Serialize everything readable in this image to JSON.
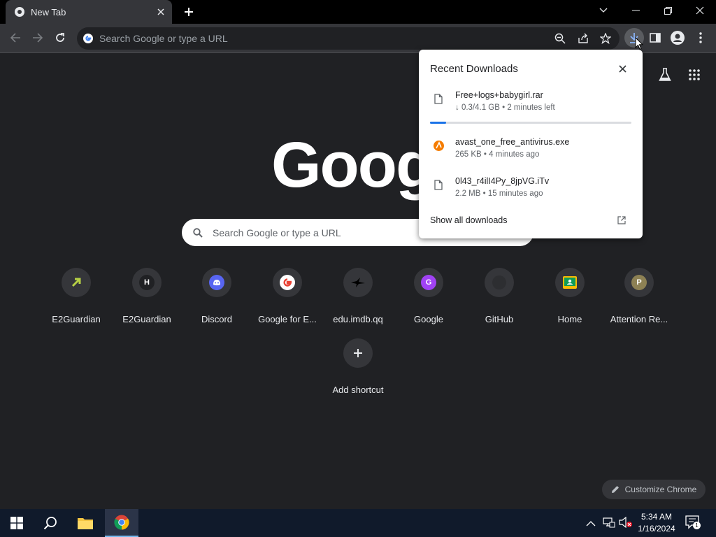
{
  "tab": {
    "title": "New Tab"
  },
  "omnibox": {
    "placeholder": "Search Google or type a URL"
  },
  "ntp": {
    "logo_text": "Googl",
    "search_placeholder": "Search Google or type a URL",
    "shortcuts": [
      {
        "label": "E2Guardian",
        "icon": "e2guardian-icon",
        "letter": ""
      },
      {
        "label": "E2Guardian",
        "icon": "letter-h-icon",
        "letter": "H"
      },
      {
        "label": "Discord",
        "icon": "discord-icon",
        "letter": ""
      },
      {
        "label": "Google for E...",
        "icon": "google-g-icon",
        "letter": ""
      },
      {
        "label": "edu.imdb.qq",
        "icon": "bird-icon",
        "letter": ""
      },
      {
        "label": "Google",
        "icon": "letter-g-icon",
        "letter": "G"
      },
      {
        "label": "GitHub",
        "icon": "github-icon",
        "letter": ""
      },
      {
        "label": "Home",
        "icon": "classroom-icon",
        "letter": ""
      },
      {
        "label": "Attention Re...",
        "icon": "letter-p-icon",
        "letter": "P"
      }
    ],
    "add_shortcut": "Add shortcut",
    "customize": "Customize Chrome"
  },
  "downloads": {
    "title": "Recent Downloads",
    "items": [
      {
        "name": "Free+logs+babygirl.rar",
        "status": "↓ 0.3/4.1 GB • 2 minutes left",
        "progress": 0.08,
        "icon": "file-icon"
      },
      {
        "name": "avast_one_free_antivirus.exe",
        "status": "265 KB • 4 minutes ago",
        "icon": "avast-icon"
      },
      {
        "name": "0l43_r4ilI4Py_8jpVG.iTv",
        "status": "2.2 MB • 15 minutes ago",
        "icon": "file-icon"
      }
    ],
    "show_all": "Show all downloads"
  },
  "taskbar": {
    "time": "5:34 AM",
    "date": "1/16/2024",
    "notification_count": "1"
  },
  "colors": {
    "accent": "#1a73e8",
    "background": "#202124",
    "toolbar": "#35363a"
  }
}
